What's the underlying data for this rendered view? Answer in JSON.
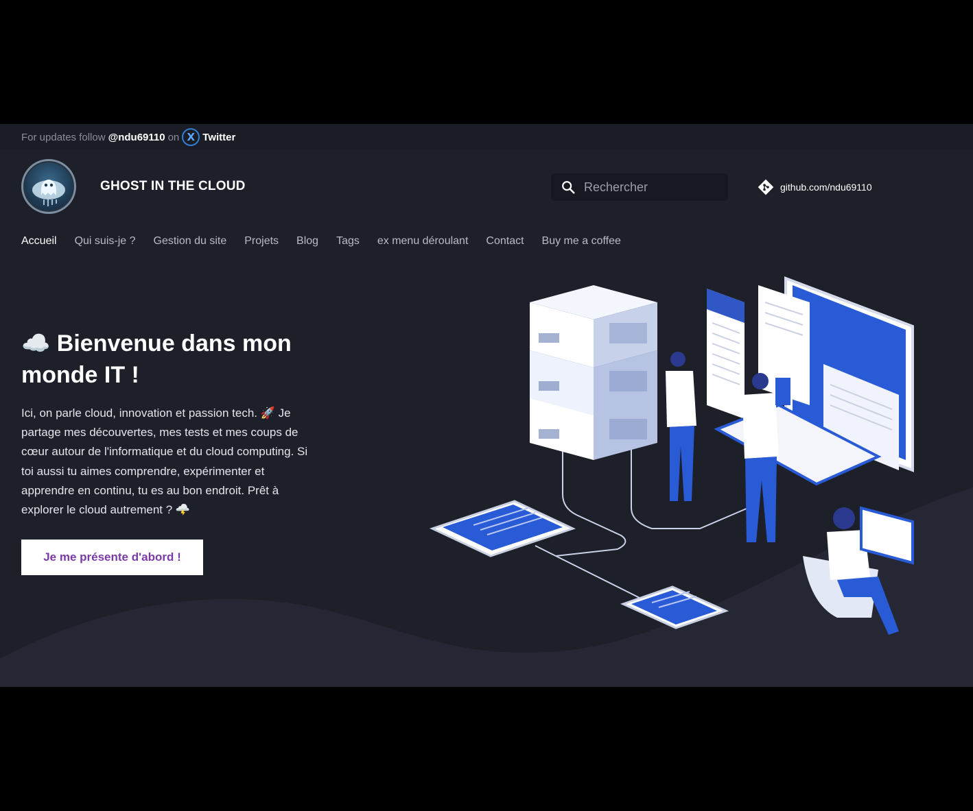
{
  "announcement": {
    "prefix": "For updates follow",
    "handle": "@ndu69110",
    "on": "on",
    "x_glyph": "X",
    "network": "Twitter"
  },
  "header": {
    "site_title": "GHOST IN THE CLOUD",
    "logo_icon": "ghost-cloud-logo",
    "search_placeholder": "Rechercher",
    "search_icon": "search-icon",
    "github_link": "github.com/ndu69110",
    "git_icon": "git-icon"
  },
  "nav": {
    "items": [
      {
        "label": "Accueil",
        "active": true
      },
      {
        "label": "Qui suis-je ?"
      },
      {
        "label": "Gestion du site"
      },
      {
        "label": "Projets"
      },
      {
        "label": "Blog"
      },
      {
        "label": "Tags"
      },
      {
        "label": "ex menu déroulant"
      },
      {
        "label": "Contact"
      },
      {
        "label": "Buy me a coffee"
      }
    ]
  },
  "hero": {
    "title": "☁️ Bienvenue dans mon monde IT !",
    "text": "Ici, on parle cloud, innovation et passion tech. 🚀 Je partage mes découvertes, mes tests et mes coups de cœur autour de l'informatique et du cloud computing. Si toi aussi tu aimes comprendre, expérimenter et apprendre en continu, tu es au bon endroit. Prêt à explorer le cloud autrement ? 🌩️",
    "cta_label": "Je me présente d'abord !"
  },
  "colors": {
    "background": "#1d1f29",
    "accent_blue": "#2a5bd7",
    "cta_text": "#7b3aa8"
  }
}
